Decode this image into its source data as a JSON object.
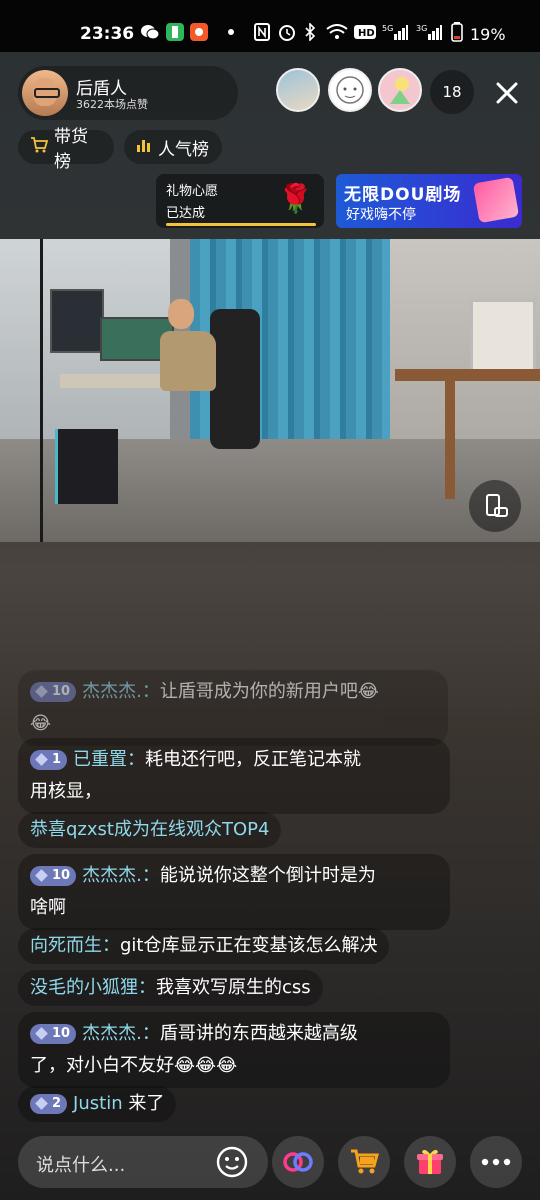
{
  "status_bar": {
    "time": "23:36",
    "battery": "19%",
    "icons": [
      "wechat-icon",
      "app-green-icon",
      "app-orange-icon",
      "dot-icon",
      "nfc-icon",
      "alarm-icon",
      "bluetooth-icon",
      "wifi-icon",
      "hd-icon",
      "signal-5g-icon",
      "signal-3g-icon",
      "battery-icon"
    ],
    "nav_5g": "5G",
    "nav_3g": "3G",
    "hd": "HD"
  },
  "host": {
    "name": "后盾人",
    "likes": "3622本场点赞"
  },
  "viewers": {
    "count": "18"
  },
  "pills": {
    "shop_rank": "带货榜",
    "popularity_rank": "人气榜"
  },
  "wish": {
    "title": "礼物心愿",
    "status": "已达成"
  },
  "banner": {
    "title": "无限DOU剧场",
    "subtitle": "好戏嗨不停"
  },
  "chat": [
    {
      "level": "10",
      "user": "杰杰杰.",
      "sep": "：",
      "text": "让盾哥成为你的新用户吧😂",
      "line2": "😂"
    },
    {
      "level": "1",
      "user": "已重置",
      "sep": "：",
      "text": "耗电还行吧，反正笔记本就",
      "line2": "用核显，"
    },
    {
      "text": "恭喜qzxst成为在线观众TOP4"
    },
    {
      "level": "10",
      "user": "杰杰杰.",
      "sep": "：",
      "text": "能说说你这整个倒计时是为",
      "line2": "啥啊"
    },
    {
      "user": "向死而生",
      "sep": "：",
      "text": "git仓库显示正在变基该怎么解决"
    },
    {
      "user": "没毛的小狐狸",
      "sep": "：",
      "text": "我喜欢写原生的css"
    },
    {
      "level": "10",
      "user": "杰杰杰.",
      "sep": "：",
      "text": "盾哥讲的东西越来越高级",
      "line2": "了，对小白不友好😂😂😂"
    },
    {
      "level": "2",
      "user": "Justin",
      "text": " 来了"
    }
  ],
  "bottom": {
    "placeholder": "说点什么..."
  },
  "colors": {
    "accent_yellow": "#f5c33b",
    "username": "#8fd8ea",
    "badge": "#6d78b8"
  }
}
